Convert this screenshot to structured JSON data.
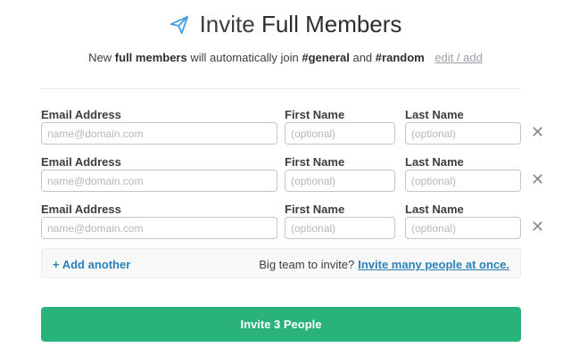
{
  "header": {
    "icon": "paper-plane-icon",
    "title_light": "Invite",
    "title_strong": "Full Members"
  },
  "subtitle": {
    "prefix": "New",
    "bold1": "full members",
    "middle": "will automatically join",
    "channel1": "#general",
    "and": "and",
    "channel2": "#random",
    "edit_link": "edit / add"
  },
  "form": {
    "labels": {
      "email": "Email Address",
      "first": "First Name",
      "last": "Last Name"
    },
    "placeholders": {
      "email": "name@domain.com",
      "first": "(optional)",
      "last": "(optional)"
    },
    "remove_glyph": "✕",
    "rows": [
      {
        "email": "",
        "first": "",
        "last": ""
      },
      {
        "email": "",
        "first": "",
        "last": ""
      },
      {
        "email": "",
        "first": "",
        "last": ""
      }
    ]
  },
  "add_bar": {
    "add_label": "+ Add another",
    "bulk_prompt": "Big team to invite?",
    "bulk_link": "Invite many people at once."
  },
  "submit": {
    "label": "Invite 3 People"
  },
  "colors": {
    "accent_green": "#2ab27b",
    "link_blue": "#2a80b9",
    "plane_blue": "#439fe0"
  }
}
